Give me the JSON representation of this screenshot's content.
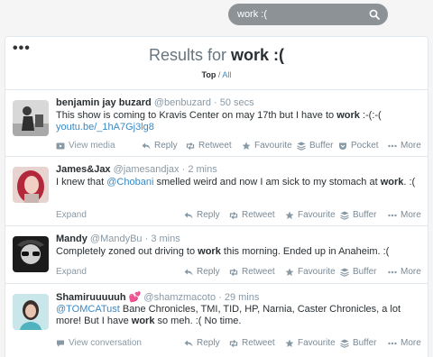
{
  "search": {
    "value": "work :("
  },
  "results": {
    "prefix": "Results for",
    "query": "work :(",
    "filter_top": "Top",
    "filter_sep": "/",
    "filter_all": "All"
  },
  "tweets": [
    {
      "name": "benjamin jay buzard",
      "handle": "@benbuzard",
      "time": "· 50 secs",
      "text_1": "This show is coming to Kravis Center on may 17th but I have to ",
      "bold": "work",
      "text_2": " :-(:-(",
      "link": "youtu.be/_1hA7Gj3lg8",
      "first_action": "View media"
    },
    {
      "name": "James&Jax",
      "handle": "@jamesandjax",
      "time": "· 2 mins",
      "text_1": "I knew that ",
      "mention": "@Chobani",
      "text_2": " smelled weird and now I am sick to my stomach at ",
      "bold": "work",
      "text_3": ". :(",
      "first_action": "Expand"
    },
    {
      "name": "Mandy",
      "handle": "@MandyBu",
      "time": "· 3 mins",
      "text_1": "Completely zoned out driving to ",
      "bold": "work",
      "text_2": " this morning. Ended up in Anaheim. :(",
      "first_action": "Expand"
    },
    {
      "name": "Shamiruuuuuh 💕",
      "handle": "@shamzmacoto",
      "time": "· 29 mins",
      "mention": "@TOMCATust",
      "text_1": " Bane Chronicles, TMI, TID, HP, Narnia, Caster Chronicles, a lot more! But I have ",
      "bold": "work",
      "text_2": " so meh. :( No time.",
      "first_action": "View conversation"
    }
  ],
  "actions": {
    "reply": "Reply",
    "retweet": "Retweet",
    "favourite": "Favourite",
    "buffer": "Buffer",
    "pocket": "Pocket",
    "more": "More"
  },
  "colors": {
    "link": "#3b88c3",
    "muted": "#8899a6",
    "search_bg": "#8d9296"
  }
}
